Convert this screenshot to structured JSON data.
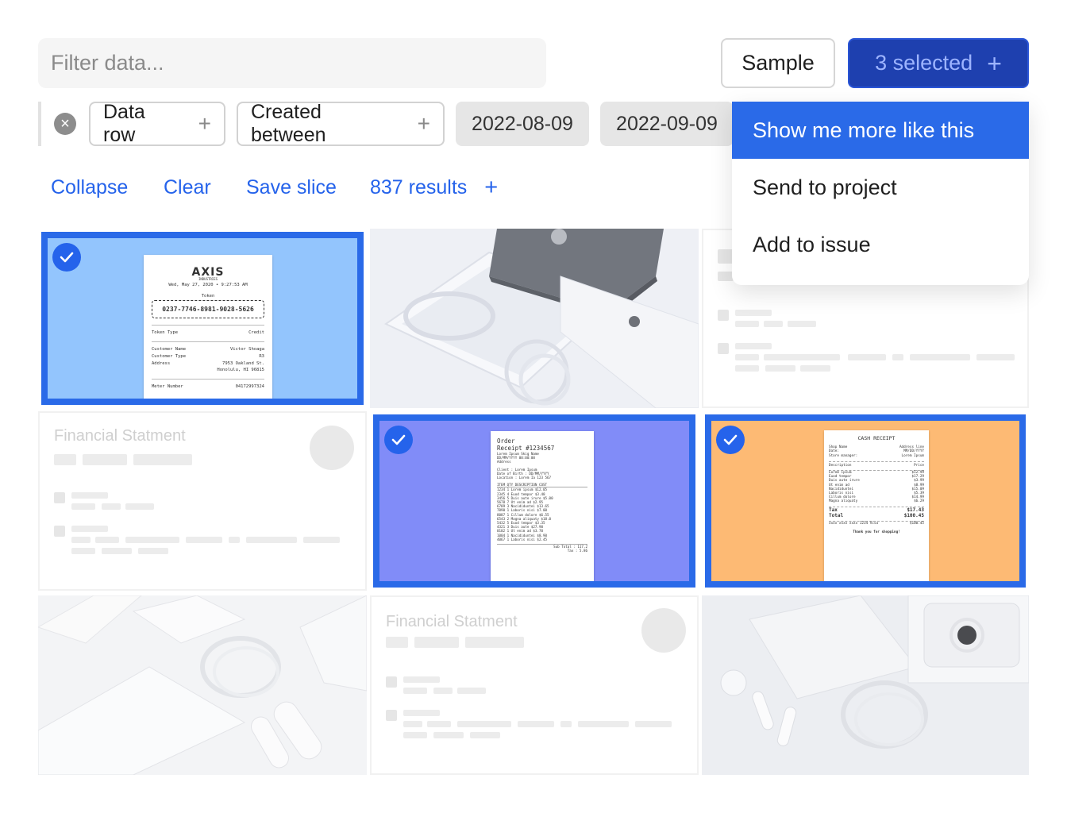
{
  "search": {
    "placeholder": "Filter data..."
  },
  "toolbar": {
    "sample_label": "Sample",
    "selected_label": "3 selected"
  },
  "filters": {
    "chips": [
      {
        "label": "Data row"
      },
      {
        "label": "Created between"
      }
    ],
    "date_from": "2022-08-09",
    "date_to": "2022-09-09"
  },
  "actions": {
    "collapse": "Collapse",
    "clear": "Clear",
    "save_slice": "Save slice",
    "results": "837 results"
  },
  "menu": {
    "items": [
      {
        "label": "Show me more like this"
      },
      {
        "label": "Send to project"
      },
      {
        "label": "Add to issue"
      }
    ]
  },
  "grid": {
    "tiles": [
      {
        "kind": "receipt-token",
        "selected": true,
        "bg": "#93c5fd"
      },
      {
        "kind": "photo-phone-box",
        "selected": false
      },
      {
        "kind": "placeholder-doc",
        "selected": false
      },
      {
        "kind": "financial-statement",
        "selected": false,
        "title": "Financial Statment"
      },
      {
        "kind": "receipt-order",
        "selected": true,
        "bg": "#818cf8"
      },
      {
        "kind": "receipt-cash",
        "selected": true,
        "bg": "#fdba74"
      },
      {
        "kind": "photo-airpods",
        "selected": false
      },
      {
        "kind": "financial-statement",
        "selected": false,
        "title": "Financial Statment"
      },
      {
        "kind": "photo-airpods-box",
        "selected": false
      }
    ],
    "token_receipt": {
      "brand": "AXIS",
      "brand_sub": "INDUSTRIES",
      "date": "Wed, May 27, 2020 • 9:27:53 AM",
      "token_label": "Token",
      "token": "0237-7746-8981-9028-5626",
      "rows": [
        [
          "Token Type",
          "Credit"
        ],
        [
          "Customer Name",
          "Victor Shoaga"
        ],
        [
          "Customer Type",
          "R3"
        ],
        [
          "Address",
          "7953 Oakland St."
        ],
        [
          "",
          "Honolulu, HI 96815"
        ],
        [
          "Meter Number",
          "04172997324"
        ]
      ]
    },
    "order_receipt": {
      "title": "Order",
      "receipt_no": "Receipt #1234567",
      "lines": [
        "Lorem Ipsum Skig Name",
        "DD/MM/YYYY 00:00:00",
        "Address"
      ],
      "meta": [
        "Client        : Lorem Ipsum",
        "Date of Birth : DD/MM/YYYY",
        "Location      : Lorem Ia 123 567"
      ],
      "header": "ITEM  QTY  DESCRIPTION      COST",
      "items": [
        "1234  1  Lorem ipsum     $12.05",
        "2345  4  Euod tempor      $3.40",
        "3456  5  Duis aute irure  $5.00",
        "5678  7  Ut enim ad       $2.95",
        "6789  3  Nacididuntei    $13.65",
        "7890  1  Laboris nisi     $7.00",
        "8087  1  Cillum dolore    $6.55",
        "6543  2  Magna aliquaty  $18.0",
        "5432  5  Euod tempor      $3.35",
        "4321  3  Duis aute       $27.90",
        "0102  1  Ut enim ad       $3.70",
        "1004  1  Nacididuntei     $8.90",
        "4067  1  Laboris nisi     $2.45"
      ],
      "subtotal": "Sub Total :   117.2",
      "tax": "Tax :      5.86"
    },
    "cash_receipt": {
      "title": "CASH RECEIPT",
      "shop": [
        [
          "Shop Name",
          "Address line"
        ],
        [
          "Date:",
          "MM/DD/YYYY"
        ],
        [
          "Store manager:",
          "Lorem Ipsum"
        ]
      ],
      "head": [
        "Description",
        "Price"
      ],
      "items": [
        [
          "Lorem ipsum",
          "$12.99"
        ],
        [
          "Euod tempor",
          "$17.29"
        ],
        [
          "Duis aute irure",
          "$3.99"
        ],
        [
          "Ut enim ad",
          "$8.99"
        ],
        [
          "Nacididuntei",
          "$15.09"
        ],
        [
          "Laboris nisi",
          "$5.39"
        ],
        [
          "Cillum dolore",
          "$14.99"
        ],
        [
          "Magna aliquaty",
          "$6.29"
        ]
      ],
      "tax": [
        "Tax",
        "$17.43"
      ],
      "total": [
        "Total",
        "$100.45"
      ],
      "card": [
        "xxxx xxxx xxxx 1234 Visa",
        "$100.45"
      ],
      "thanks": "Thank you for shopping!"
    }
  },
  "colors": {
    "accent": "#2563eb",
    "primary_button": "#1e40af",
    "menu_active": "#2a6ae8"
  }
}
